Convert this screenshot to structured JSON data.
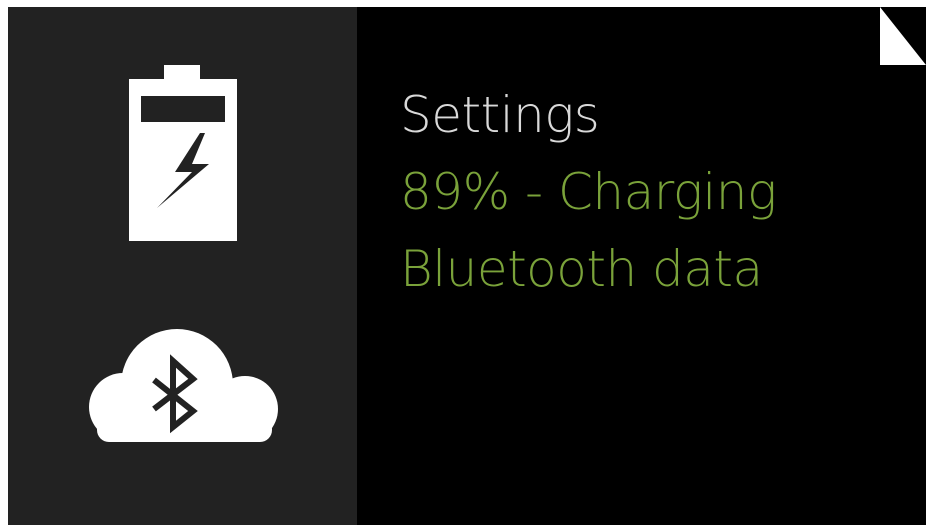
{
  "card": {
    "title": "Settings",
    "battery_status": "89% - Charging",
    "bluetooth_status": "Bluetooth data"
  },
  "icons": {
    "battery": "battery-charging-icon",
    "bluetooth": "bluetooth-cloud-icon",
    "corner": "page-fold-icon"
  },
  "colors": {
    "background": "#000000",
    "left_panel": "#222222",
    "title_text": "#d9d9d9",
    "status_text": "#7aa23a",
    "icon": "#ffffff"
  }
}
